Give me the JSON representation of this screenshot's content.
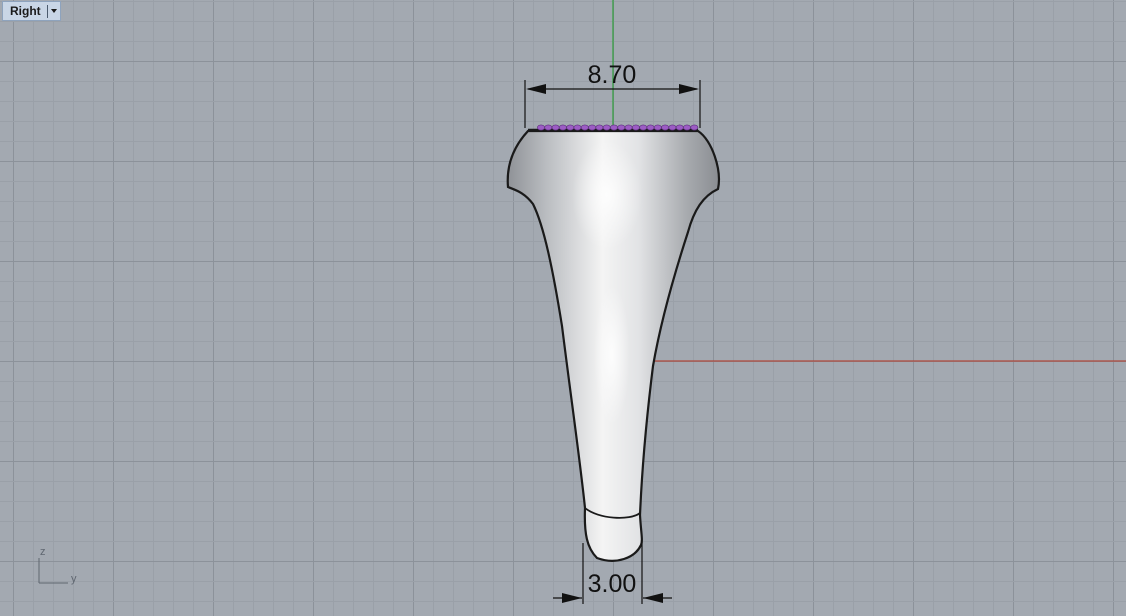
{
  "viewport": {
    "name": "Right",
    "background": "#a3a9b1",
    "grid_minor_color": "#9aa0a8",
    "grid_major_color": "#8c929a",
    "x_axis_color": "#b04a3c",
    "y_axis_color": "#2e9e3c"
  },
  "dimensions": {
    "top": "8.70",
    "bottom": "3.00"
  },
  "axis_widget": {
    "vertical": "z",
    "horizontal": "y"
  },
  "model": {
    "fill": "#e6e6e6",
    "outline": "#1a1a1a",
    "gem_color": "#9c5cc4"
  }
}
